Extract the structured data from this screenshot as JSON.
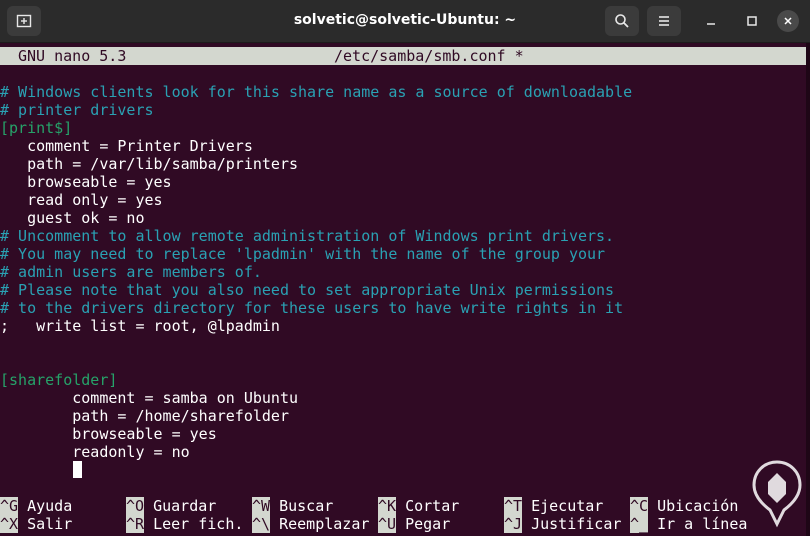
{
  "window": {
    "title": "solvetic@solvetic-Ubuntu: ~",
    "new_tab_icon": "new-tab-icon",
    "search_icon": "search-icon",
    "menu_icon": "hamburger-menu-icon",
    "minimize_icon": "minimize-icon",
    "maximize_icon": "maximize-icon",
    "close_icon": "close-icon"
  },
  "colors": {
    "terminal_bg": "#300a24",
    "comment": "#2aa1b3",
    "section": "#26a269",
    "header_bg": "#d3d7cf"
  },
  "nano": {
    "version": "GNU nano 5.3",
    "file": "/etc/samba/smb.conf *"
  },
  "editor": {
    "l1": "# Windows clients look for this share name as a source of downloadable",
    "l2": "# printer drivers",
    "l3": "[print$]",
    "l4": "   comment = Printer Drivers",
    "l5": "   path = /var/lib/samba/printers",
    "l6": "   browseable = yes",
    "l7": "   read only = yes",
    "l8": "   guest ok = no",
    "l9": "# Uncomment to allow remote administration of Windows print drivers.",
    "l10": "# You may need to replace 'lpadmin' with the name of the group your",
    "l11": "# admin users are members of.",
    "l12": "# Please note that you also need to set appropriate Unix permissions",
    "l13": "# to the drivers directory for these users to have write rights in it",
    "l14": ";   write list = root, @lpadmin",
    "l15": "[sharefolder]",
    "l16": "        comment = samba on Ubuntu",
    "l17": "        path = /home/sharefolder",
    "l18": "        browseable = yes",
    "l19": "        readonly = no"
  },
  "shortcuts": [
    {
      "key": "^G",
      "label": "Ayuda"
    },
    {
      "key": "^O",
      "label": "Guardar"
    },
    {
      "key": "^W",
      "label": "Buscar"
    },
    {
      "key": "^K",
      "label": "Cortar"
    },
    {
      "key": "^T",
      "label": "Ejecutar"
    },
    {
      "key": "^C",
      "label": "Ubicación"
    },
    {
      "key": "^X",
      "label": "Salir"
    },
    {
      "key": "^R",
      "label": "Leer fich."
    },
    {
      "key": "^\\",
      "label": "Reemplazar"
    },
    {
      "key": "^U",
      "label": "Pegar"
    },
    {
      "key": "^J",
      "label": "Justificar"
    },
    {
      "key": "^_",
      "label": "Ir a línea"
    }
  ],
  "logo": "solvetic-logo"
}
